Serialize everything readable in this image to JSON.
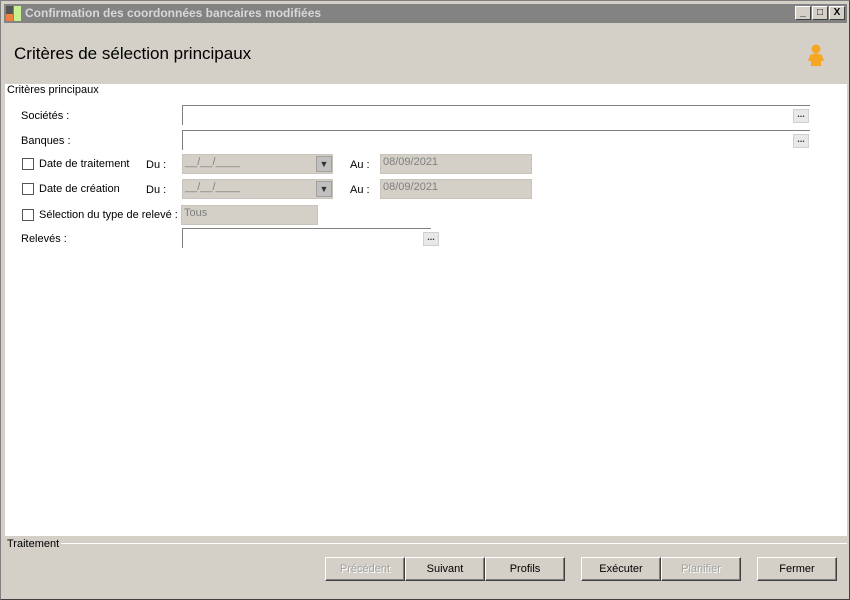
{
  "window": {
    "title": "Confirmation des coordonnées bancaires modifiées",
    "minimize": "_",
    "maximize": "□",
    "close": "X"
  },
  "header": {
    "title": "Critères de sélection principaux"
  },
  "main": {
    "group_label": "Critères principaux",
    "societes_label": "Sociétés :",
    "banques_label": "Banques :",
    "date_traitement": {
      "label": "Date de traitement",
      "du_label": "Du :",
      "du_value": "__/__/____",
      "au_label": "Au :",
      "au_value": "08/09/2021",
      "checked": false
    },
    "date_creation": {
      "label": "Date de création",
      "du_label": "Du :",
      "du_value": "__/__/____",
      "au_label": "Au :",
      "au_value": "08/09/2021",
      "checked": false
    },
    "type_releve": {
      "label": "Sélection du type de relevé :",
      "value": "Tous",
      "checked": false
    },
    "releves_label": "Relevés :",
    "browse": "..."
  },
  "footer": {
    "group_label": "Traitement",
    "buttons": {
      "precedent": "Précédent",
      "suivant": "Suivant",
      "profils": "Profils",
      "executer": "Exécuter",
      "planifier": "Planifier",
      "fermer": "Fermer"
    }
  }
}
